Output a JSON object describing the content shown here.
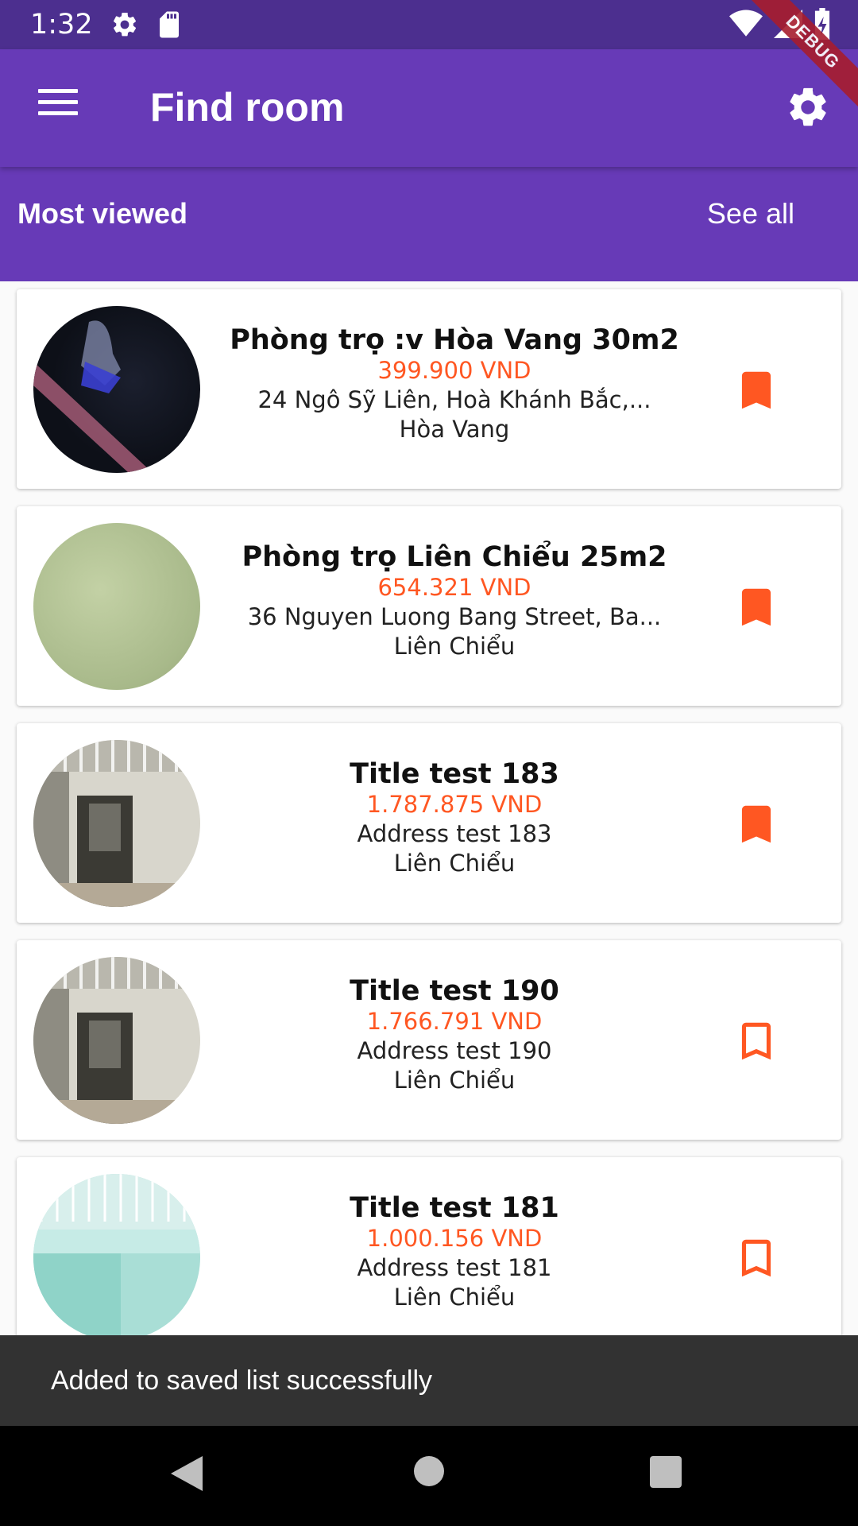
{
  "status_bar": {
    "time": "1:32"
  },
  "debug_ribbon": "DEBUG",
  "app_bar": {
    "title": "Find room"
  },
  "section": {
    "title": "Most viewed",
    "see_all": "See all"
  },
  "rooms": [
    {
      "title": "Phòng trọ :v Hòa Vang 30m2",
      "price": "399.900 VND",
      "address": "24 Ngô Sỹ Liên, Hoà Khánh Bắc,...",
      "district": "Hòa Vang",
      "saved": true
    },
    {
      "title": "Phòng trọ Liên Chiểu 25m2",
      "price": "654.321 VND",
      "address": "36 Nguyen Luong Bang Street, Ba...",
      "district": "Liên Chiểu",
      "saved": true
    },
    {
      "title": "Title test 183",
      "price": "1.787.875 VND",
      "address": "Address test 183",
      "district": "Liên Chiểu",
      "saved": true
    },
    {
      "title": "Title test 190",
      "price": "1.766.791 VND",
      "address": "Address test 190",
      "district": "Liên Chiểu",
      "saved": false
    },
    {
      "title": "Title test 181",
      "price": "1.000.156 VND",
      "address": "Address test 181",
      "district": "Liên Chiểu",
      "saved": false
    }
  ],
  "snackbar": {
    "message": "Added to saved list successfully"
  },
  "colors": {
    "primary": "#673ab7",
    "status_bar": "#4c2f8f",
    "accent": "#ff5722"
  }
}
